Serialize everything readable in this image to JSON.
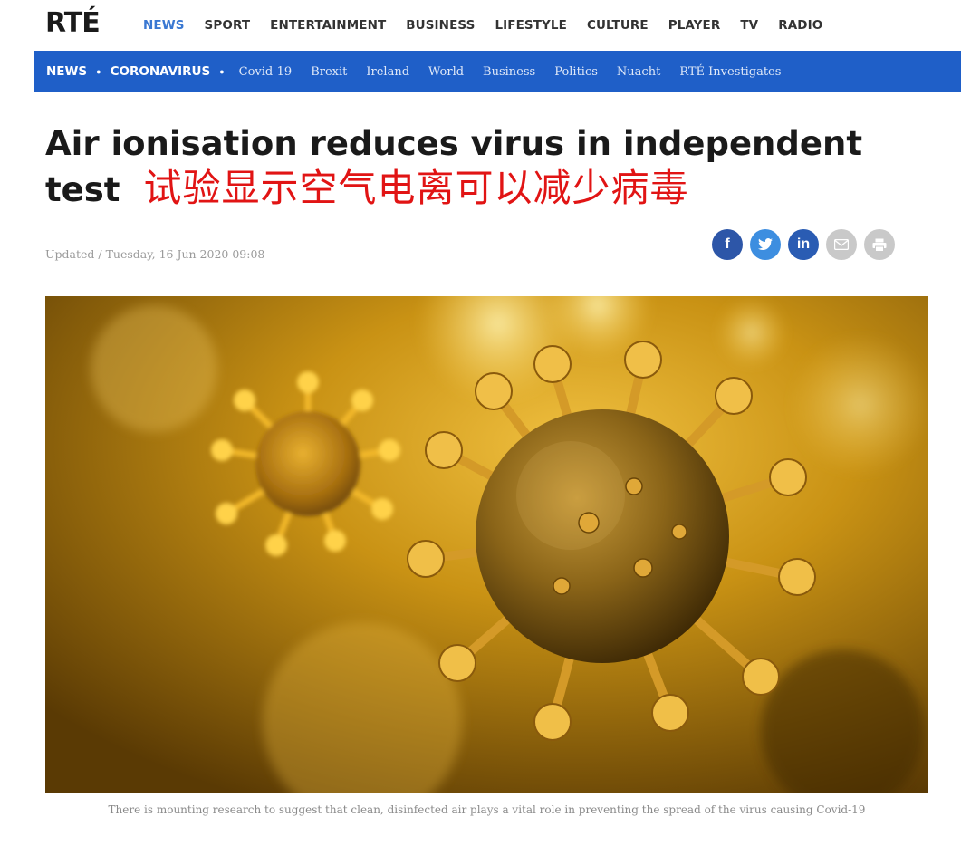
{
  "brand": {
    "logo_text": "RTÉ"
  },
  "top_menu": [
    "NEWS",
    "SPORT",
    "ENTERTAINMENT",
    "BUSINESS",
    "LIFESTYLE",
    "CULTURE",
    "PLAYER",
    "TV",
    "RADIO"
  ],
  "sub_nav": {
    "crumbs": [
      "NEWS",
      "CORONAVIRUS"
    ],
    "links": [
      "Covid-19",
      "Brexit",
      "Ireland",
      "World",
      "Business",
      "Politics",
      "Nuacht",
      "RTÉ Investigates"
    ]
  },
  "article": {
    "headline_line1": "Air ionisation reduces virus in independent",
    "headline_line2": "test",
    "headline_cn": "试验显示空气电离可以减少病毒",
    "updated": "Updated / Tuesday, 16 Jun 2020 09:08",
    "caption": "There is mounting research to suggest that clean, disinfected air plays a vital role in preventing the spread of the virus causing Covid-19"
  },
  "share": [
    {
      "name": "facebook-icon",
      "glyph": "f"
    },
    {
      "name": "twitter-icon",
      "glyph": "t"
    },
    {
      "name": "linkedin-icon",
      "glyph": "in"
    },
    {
      "name": "email-icon",
      "glyph": "✉"
    },
    {
      "name": "print-icon",
      "glyph": "⎙"
    }
  ],
  "colors": {
    "brand_blue": "#1f5fc8",
    "active_link": "#3a78d2",
    "cn_headline": "#e11414"
  }
}
